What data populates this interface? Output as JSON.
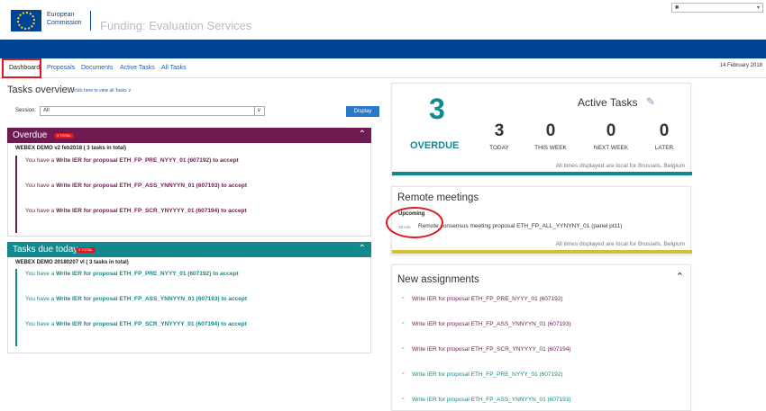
{
  "header": {
    "org_line1": "European",
    "org_line2": "Commission",
    "app_title": "Funding: Evaluation Services",
    "user_icon": "user-icon"
  },
  "nav": {
    "tabs": [
      {
        "label": "Dashboard",
        "active": true
      },
      {
        "label": "Proposals"
      },
      {
        "label": "Documents"
      },
      {
        "label": "Active Tasks"
      },
      {
        "label": "All Tasks"
      }
    ],
    "date": "14 February 2018"
  },
  "tasks_overview": {
    "title": "Tasks overview",
    "link": "click here to view all Tasks ∨",
    "session_label": "Session:",
    "session_value": "All",
    "display_button": "Display",
    "overdue": {
      "title": "Overdue",
      "badge": "3 TOTAL",
      "group": "WEBEX DEMO v2 feb2018 ( 3 tasks in total)",
      "items": [
        {
          "pre": "You have a ",
          "strong": "Write IER for proposal ETH_FP_PRE_NYYY_01 (607192) to accept"
        },
        {
          "pre": "You have a ",
          "strong": "Write IER for proposal ETH_FP_ASS_YNNYYN_01 (607193) to accept"
        },
        {
          "pre": "You have a ",
          "strong": "Write IER for proposal ETH_FP_SCR_YNYYYY_01 (607194) to accept"
        }
      ]
    },
    "due_today": {
      "title": "Tasks due today",
      "badge": "3 TOTAL",
      "group": "WEBEX DEMO 20180207 vl ( 3 tasks in total)",
      "items": [
        {
          "pre": "You have a ",
          "strong": "Write IER for proposal ETH_FP_PRE_NYYY_01 (607192) to accept"
        },
        {
          "pre": "You have a ",
          "strong": "Write IER for proposal ETH_FP_ASS_YNNYYN_01 (607193) to accept"
        },
        {
          "pre": "You have a ",
          "strong": "Write IER for proposal ETH_FP_SCR_YNYYYY_01 (607194) to accept"
        }
      ]
    }
  },
  "active_tasks": {
    "overdue_count": "3",
    "overdue_label": "OVERDUE",
    "title": "Active Tasks",
    "stats": [
      {
        "n": "3",
        "label": "TODAY"
      },
      {
        "n": "0",
        "label": "THIS WEEK"
      },
      {
        "n": "0",
        "label": "NEXT WEEK"
      },
      {
        "n": "0",
        "label": "LATER"
      }
    ],
    "footer": "All times displayed are local for Brussels, Belgium"
  },
  "remote_meetings": {
    "title": "Remote meetings",
    "upcoming": "Upcoming",
    "time": "15 min",
    "text": "Remote consensus meeting proposal ETH_FP_ALL_YYNYNY_01 (panel pt11)",
    "footer": "All times displayed are local for Brussels, Belgium"
  },
  "new_assignments": {
    "title": "New assignments",
    "items": [
      "Write IER for proposal ETH_FP_PRE_NYYY_01 (607192)",
      "Write IER for proposal ETH_FP_ASS_YNNYYN_01 (607193)",
      "Write IER for proposal ETH_FP_SCR_YNYYYY_01 (607194)",
      "Write IER for proposal ETH_FP_PRE_NYYY_01 (607192)",
      "Write IER for proposal ETH_FP_ASS_YNNYYN_01 (607193)"
    ]
  },
  "colors": {
    "overdue": "#6e1b52",
    "due_today": "#11898f",
    "brand_blue": "#004494",
    "remote_bar": "#d4c12e"
  }
}
